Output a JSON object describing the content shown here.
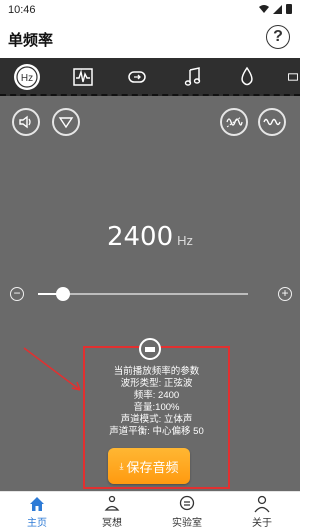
{
  "status_bar": {
    "time": "10:46"
  },
  "header": {
    "title": "单频率",
    "help_label": "?"
  },
  "tabs": [
    {
      "icon": "hz-icon",
      "label": "Hz",
      "active": true
    },
    {
      "icon": "waveform-monitor-icon",
      "active": false
    },
    {
      "icon": "loop-icon",
      "active": false
    },
    {
      "icon": "music-note-icon",
      "active": false
    },
    {
      "icon": "droplet-icon",
      "active": false
    }
  ],
  "controls": {
    "volume_icon": "speaker-icon",
    "down_icon": "triangle-down-icon",
    "sweep_icon": "sweep-wave-icon",
    "waveform_icon": "sine-wave-icon"
  },
  "frequency": {
    "value": "2400",
    "unit": "Hz"
  },
  "slider": {
    "minus": "−",
    "plus": "+",
    "fraction": 0.12
  },
  "params": {
    "title": "当前播放频率的参数",
    "waveform": "波形类型: 正弦波",
    "frequency": "频率: 2400",
    "volume": "音量:100%",
    "channel_mode": "声道模式: 立体声",
    "balance": "声道平衡: 中心偏移 50"
  },
  "save": {
    "label": "保存音频"
  },
  "bottom_nav": [
    {
      "label": "主页",
      "icon": "home-icon",
      "active": true
    },
    {
      "label": "冥想",
      "icon": "meditation-icon",
      "active": false
    },
    {
      "label": "实验室",
      "icon": "lab-icon",
      "active": false
    },
    {
      "label": "关于",
      "icon": "person-icon",
      "active": false
    }
  ],
  "colors": {
    "panel_bg": "#6a6a6a",
    "tab_bg": "#2f2f2f",
    "highlight_red": "#e23030",
    "save_orange": "#ff9a10",
    "nav_active": "#2e7bd6"
  }
}
